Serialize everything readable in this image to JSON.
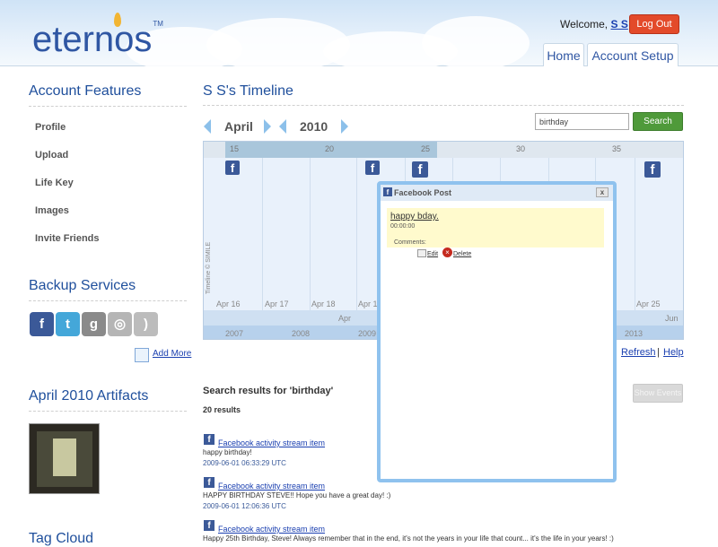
{
  "header": {
    "logo_text": "eternos",
    "logo_tm": "TM",
    "welcome_prefix": "Welcome,",
    "username": "S S",
    "logout_label": "Log Out",
    "tabs": [
      {
        "label": "Home"
      },
      {
        "label": "Account Setup"
      }
    ]
  },
  "sidebar": {
    "account_features_title": "Account Features",
    "items": [
      {
        "label": "Profile"
      },
      {
        "label": "Upload"
      },
      {
        "label": "Life Key"
      },
      {
        "label": "Images"
      },
      {
        "label": "Invite Friends"
      }
    ],
    "backup_title": "Backup Services",
    "backup_icons": [
      {
        "icon": "facebook-icon",
        "glyph": "f",
        "color": "#3b5998"
      },
      {
        "icon": "twitter-icon",
        "glyph": "t",
        "color": "#44a7d9"
      },
      {
        "icon": "google-icon",
        "glyph": "g",
        "color": "#8a8a8a"
      },
      {
        "icon": "picasa-icon",
        "glyph": "◎",
        "color": "#b5b5b5"
      },
      {
        "icon": "rss-icon",
        "glyph": ")",
        "color": "#bcbcbc"
      }
    ],
    "add_more_label": "Add More",
    "artifacts_title": "April 2010 Artifacts",
    "tag_cloud_title": "Tag Cloud"
  },
  "main": {
    "title": "S S's Timeline",
    "month": "April",
    "year": "2010",
    "search_value": "birthday",
    "search_button": "Search",
    "timeline": {
      "top_ticks": [
        "15",
        "20",
        "25",
        "30",
        "35"
      ],
      "day_labels": [
        "Apr 16",
        "Apr 17",
        "Apr 18",
        "Apr 19",
        "Apr 25"
      ],
      "month_labels": [
        "Apr",
        "Jun"
      ],
      "year_labels": [
        "2007",
        "2008",
        "2009",
        "2013"
      ],
      "credit": "Timeline © SIMILE"
    },
    "popup": {
      "header": "Facebook Post",
      "close": "x",
      "post_title": "happy bday.",
      "post_time": "00:00:00",
      "comments_label": "Comments:",
      "edit_label": "Edit",
      "delete_label": "Delete"
    },
    "refresh_label": "Refresh",
    "help_label": "Help",
    "results_heading": "Search results for 'birthday'",
    "results_count": "20 results",
    "show_events_label": "Show Events",
    "results": [
      {
        "link": "Facebook activity stream item",
        "text": "happy birthday!",
        "date": "2009-06-01 06:33:29 UTC"
      },
      {
        "link": "Facebook activity stream item",
        "text": "HAPPY BIRTHDAY STEVE!! Hope you have a great day! :)",
        "date": "2009-06-01 12:06:36 UTC"
      },
      {
        "link": "Facebook activity stream item",
        "text": "Happy 25th Birthday, Steve! Always remember that in the end, it's not the years in your life that count... it's the life in your years! :)",
        "date": ""
      }
    ]
  },
  "colors": {
    "brand_blue": "#2f56a3",
    "logout_red": "#e34a2a",
    "search_green": "#4f9a3a",
    "facebook_blue": "#3b5998"
  }
}
